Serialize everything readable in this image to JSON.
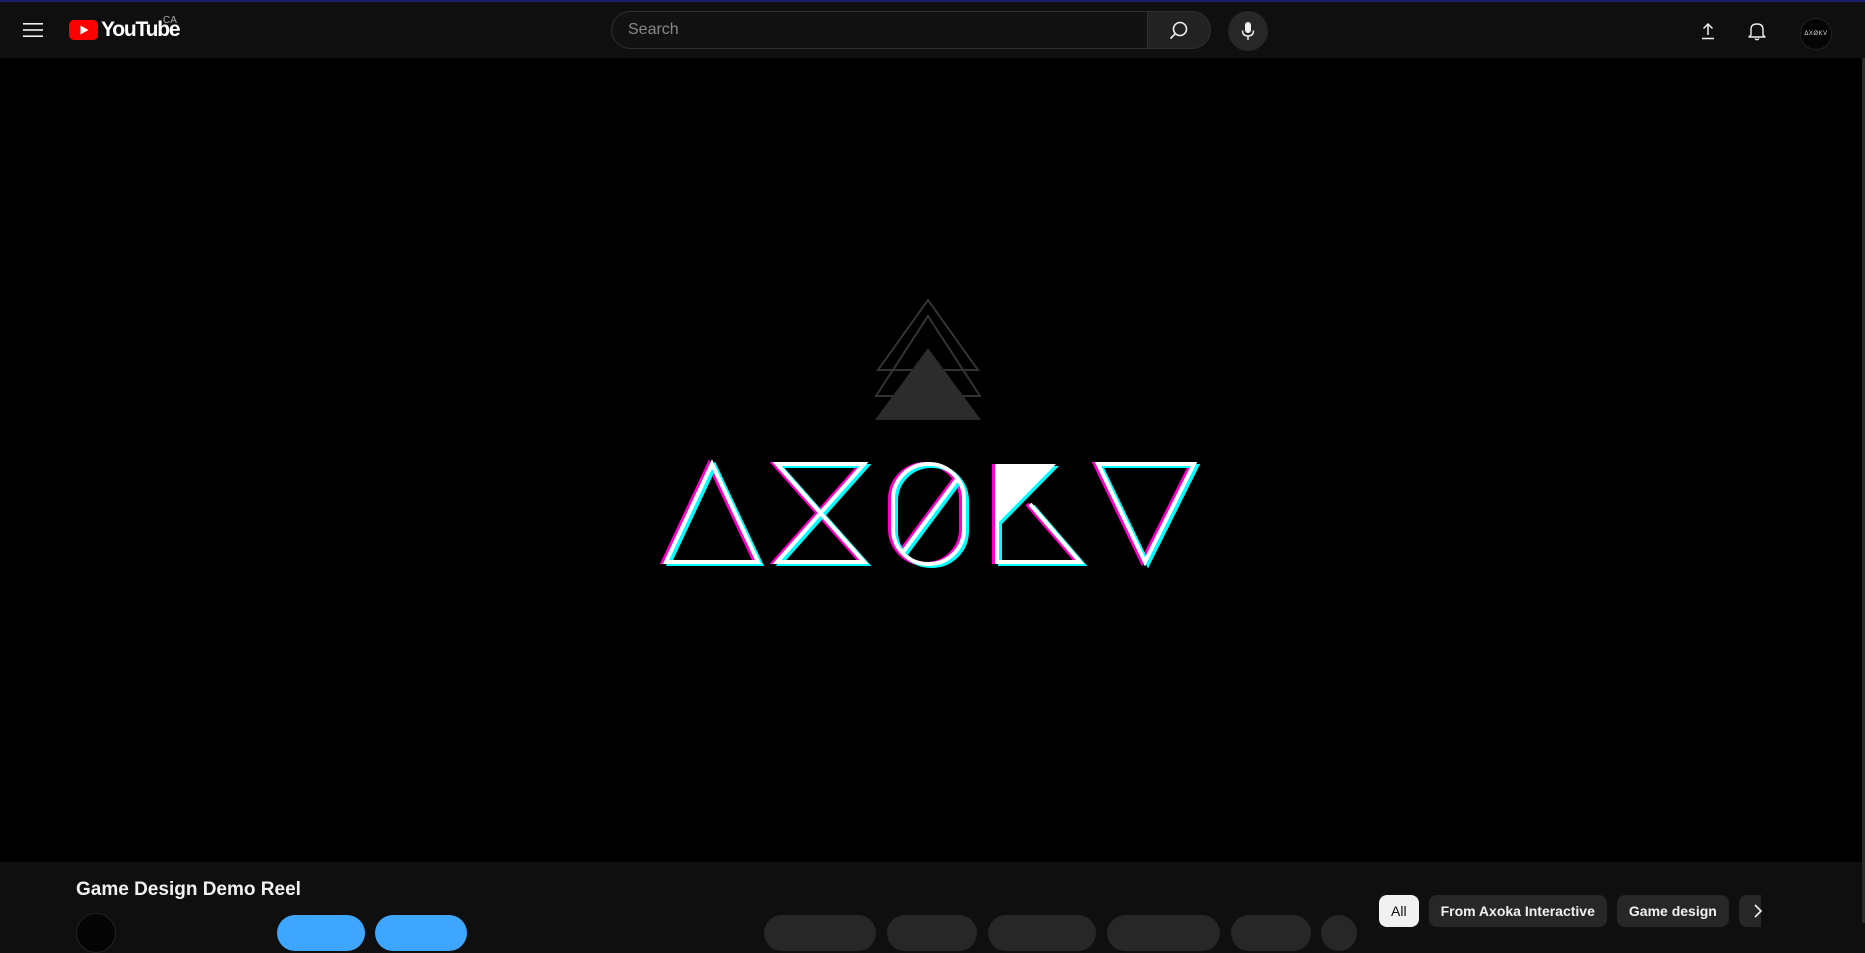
{
  "header": {
    "logo_text": "YouTube",
    "country_code": "CA",
    "search_placeholder": "Search",
    "icons": [
      "menu-icon",
      "youtube-logo-icon",
      "search-icon",
      "microphone-icon",
      "upload-icon",
      "bell-icon"
    ],
    "avatar_text": "ΔXØKV"
  },
  "player": {
    "logo_wordmark": "ΔXØKV"
  },
  "video": {
    "title": "Game Design Demo Reel"
  },
  "chips": [
    {
      "label": "All",
      "active": true
    },
    {
      "label": "From Axoka Interactive",
      "active": false
    },
    {
      "label": "Game design",
      "active": false
    }
  ],
  "colors": {
    "background": "#0f0f0f",
    "player": "#000000",
    "accent_red": "#ff0000",
    "subscribe_blue": "#3ea6ff",
    "glitch_cyan": "#00ffff",
    "glitch_magenta": "#ff00c8"
  }
}
